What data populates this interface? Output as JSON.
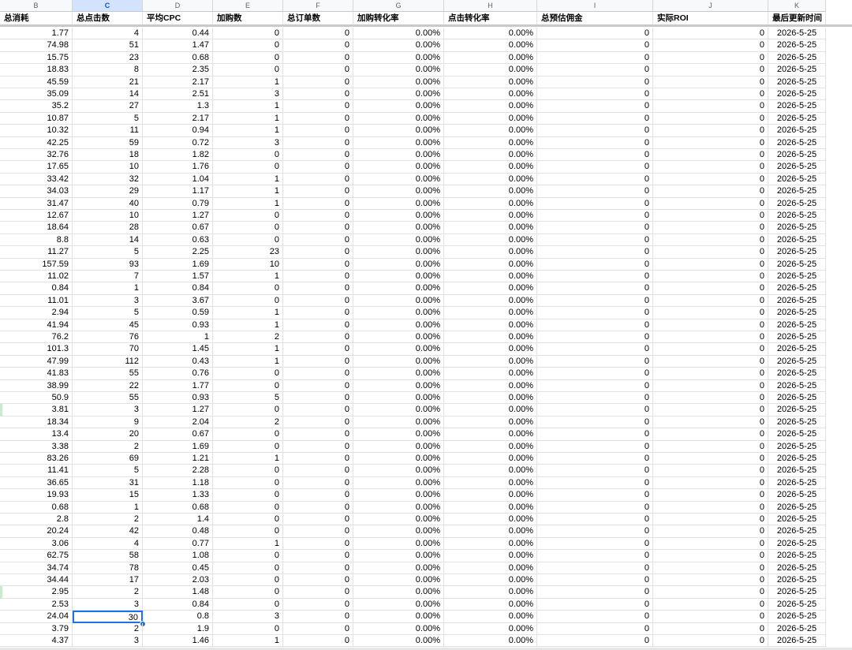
{
  "sheet": {
    "column_letters": [
      "B",
      "C",
      "D",
      "E",
      "F",
      "G",
      "H",
      "I",
      "J",
      "K"
    ],
    "selected_column": "C",
    "headers": [
      "总消耗",
      "总点击数",
      "平均CPC",
      "加购数",
      "总订单数",
      "加购转化率",
      "点击转化率",
      "总预估佣金",
      "实际ROI",
      "最后更新时间"
    ],
    "rows": [
      [
        "1.77",
        "4",
        "0.44",
        "0",
        "0",
        "0.00%",
        "0.00%",
        "0",
        "0",
        "2026-5-25"
      ],
      [
        "74.98",
        "51",
        "1.47",
        "0",
        "0",
        "0.00%",
        "0.00%",
        "0",
        "0",
        "2026-5-25"
      ],
      [
        "15.75",
        "23",
        "0.68",
        "0",
        "0",
        "0.00%",
        "0.00%",
        "0",
        "0",
        "2026-5-25"
      ],
      [
        "18.83",
        "8",
        "2.35",
        "0",
        "0",
        "0.00%",
        "0.00%",
        "0",
        "0",
        "2026-5-25"
      ],
      [
        "45.59",
        "21",
        "2.17",
        "1",
        "0",
        "0.00%",
        "0.00%",
        "0",
        "0",
        "2026-5-25"
      ],
      [
        "35.09",
        "14",
        "2.51",
        "3",
        "0",
        "0.00%",
        "0.00%",
        "0",
        "0",
        "2026-5-25"
      ],
      [
        "35.2",
        "27",
        "1.3",
        "1",
        "0",
        "0.00%",
        "0.00%",
        "0",
        "0",
        "2026-5-25"
      ],
      [
        "10.87",
        "5",
        "2.17",
        "1",
        "0",
        "0.00%",
        "0.00%",
        "0",
        "0",
        "2026-5-25"
      ],
      [
        "10.32",
        "11",
        "0.94",
        "1",
        "0",
        "0.00%",
        "0.00%",
        "0",
        "0",
        "2026-5-25"
      ],
      [
        "42.25",
        "59",
        "0.72",
        "3",
        "0",
        "0.00%",
        "0.00%",
        "0",
        "0",
        "2026-5-25"
      ],
      [
        "32.76",
        "18",
        "1.82",
        "0",
        "0",
        "0.00%",
        "0.00%",
        "0",
        "0",
        "2026-5-25"
      ],
      [
        "17.65",
        "10",
        "1.76",
        "0",
        "0",
        "0.00%",
        "0.00%",
        "0",
        "0",
        "2026-5-25"
      ],
      [
        "33.42",
        "32",
        "1.04",
        "1",
        "0",
        "0.00%",
        "0.00%",
        "0",
        "0",
        "2026-5-25"
      ],
      [
        "34.03",
        "29",
        "1.17",
        "1",
        "0",
        "0.00%",
        "0.00%",
        "0",
        "0",
        "2026-5-25"
      ],
      [
        "31.47",
        "40",
        "0.79",
        "1",
        "0",
        "0.00%",
        "0.00%",
        "0",
        "0",
        "2026-5-25"
      ],
      [
        "12.67",
        "10",
        "1.27",
        "0",
        "0",
        "0.00%",
        "0.00%",
        "0",
        "0",
        "2026-5-25"
      ],
      [
        "18.64",
        "28",
        "0.67",
        "0",
        "0",
        "0.00%",
        "0.00%",
        "0",
        "0",
        "2026-5-25"
      ],
      [
        "8.8",
        "14",
        "0.63",
        "0",
        "0",
        "0.00%",
        "0.00%",
        "0",
        "0",
        "2026-5-25"
      ],
      [
        "11.27",
        "5",
        "2.25",
        "23",
        "0",
        "0.00%",
        "0.00%",
        "0",
        "0",
        "2026-5-25"
      ],
      [
        "157.59",
        "93",
        "1.69",
        "10",
        "0",
        "0.00%",
        "0.00%",
        "0",
        "0",
        "2026-5-25"
      ],
      [
        "11.02",
        "7",
        "1.57",
        "1",
        "0",
        "0.00%",
        "0.00%",
        "0",
        "0",
        "2026-5-25"
      ],
      [
        "0.84",
        "1",
        "0.84",
        "0",
        "0",
        "0.00%",
        "0.00%",
        "0",
        "0",
        "2026-5-25"
      ],
      [
        "11.01",
        "3",
        "3.67",
        "0",
        "0",
        "0.00%",
        "0.00%",
        "0",
        "0",
        "2026-5-25"
      ],
      [
        "2.94",
        "5",
        "0.59",
        "1",
        "0",
        "0.00%",
        "0.00%",
        "0",
        "0",
        "2026-5-25"
      ],
      [
        "41.94",
        "45",
        "0.93",
        "1",
        "0",
        "0.00%",
        "0.00%",
        "0",
        "0",
        "2026-5-25"
      ],
      [
        "76.2",
        "76",
        "1",
        "2",
        "0",
        "0.00%",
        "0.00%",
        "0",
        "0",
        "2026-5-25"
      ],
      [
        "101.3",
        "70",
        "1.45",
        "1",
        "0",
        "0.00%",
        "0.00%",
        "0",
        "0",
        "2026-5-25"
      ],
      [
        "47.99",
        "112",
        "0.43",
        "1",
        "0",
        "0.00%",
        "0.00%",
        "0",
        "0",
        "2026-5-25"
      ],
      [
        "41.83",
        "55",
        "0.76",
        "0",
        "0",
        "0.00%",
        "0.00%",
        "0",
        "0",
        "2026-5-25"
      ],
      [
        "38.99",
        "22",
        "1.77",
        "0",
        "0",
        "0.00%",
        "0.00%",
        "0",
        "0",
        "2026-5-25"
      ],
      [
        "50.9",
        "55",
        "0.93",
        "5",
        "0",
        "0.00%",
        "0.00%",
        "0",
        "0",
        "2026-5-25"
      ],
      [
        "3.81",
        "3",
        "1.27",
        "0",
        "0",
        "0.00%",
        "0.00%",
        "0",
        "0",
        "2026-5-25"
      ],
      [
        "18.34",
        "9",
        "2.04",
        "2",
        "0",
        "0.00%",
        "0.00%",
        "0",
        "0",
        "2026-5-25"
      ],
      [
        "13.4",
        "20",
        "0.67",
        "0",
        "0",
        "0.00%",
        "0.00%",
        "0",
        "0",
        "2026-5-25"
      ],
      [
        "3.38",
        "2",
        "1.69",
        "0",
        "0",
        "0.00%",
        "0.00%",
        "0",
        "0",
        "2026-5-25"
      ],
      [
        "83.26",
        "69",
        "1.21",
        "1",
        "0",
        "0.00%",
        "0.00%",
        "0",
        "0",
        "2026-5-25"
      ],
      [
        "11.41",
        "5",
        "2.28",
        "0",
        "0",
        "0.00%",
        "0.00%",
        "0",
        "0",
        "2026-5-25"
      ],
      [
        "36.65",
        "31",
        "1.18",
        "0",
        "0",
        "0.00%",
        "0.00%",
        "0",
        "0",
        "2026-5-25"
      ],
      [
        "19.93",
        "15",
        "1.33",
        "0",
        "0",
        "0.00%",
        "0.00%",
        "0",
        "0",
        "2026-5-25"
      ],
      [
        "0.68",
        "1",
        "0.68",
        "0",
        "0",
        "0.00%",
        "0.00%",
        "0",
        "0",
        "2026-5-25"
      ],
      [
        "2.8",
        "2",
        "1.4",
        "0",
        "0",
        "0.00%",
        "0.00%",
        "0",
        "0",
        "2026-5-25"
      ],
      [
        "20.24",
        "42",
        "0.48",
        "0",
        "0",
        "0.00%",
        "0.00%",
        "0",
        "0",
        "2026-5-25"
      ],
      [
        "3.06",
        "4",
        "0.77",
        "1",
        "0",
        "0.00%",
        "0.00%",
        "0",
        "0",
        "2026-5-25"
      ],
      [
        "62.75",
        "58",
        "1.08",
        "0",
        "0",
        "0.00%",
        "0.00%",
        "0",
        "0",
        "2026-5-25"
      ],
      [
        "34.74",
        "78",
        "0.45",
        "0",
        "0",
        "0.00%",
        "0.00%",
        "0",
        "0",
        "2026-5-25"
      ],
      [
        "34.44",
        "17",
        "2.03",
        "0",
        "0",
        "0.00%",
        "0.00%",
        "0",
        "0",
        "2026-5-25"
      ],
      [
        "2.95",
        "2",
        "1.48",
        "0",
        "0",
        "0.00%",
        "0.00%",
        "0",
        "0",
        "2026-5-25"
      ],
      [
        "2.53",
        "3",
        "0.84",
        "0",
        "0",
        "0.00%",
        "0.00%",
        "0",
        "0",
        "2026-5-25"
      ],
      [
        "24.04",
        "30",
        "0.8",
        "3",
        "0",
        "0.00%",
        "0.00%",
        "0",
        "0",
        "2026-5-25"
      ],
      [
        "3.79",
        "2",
        "1.9",
        "0",
        "0",
        "0.00%",
        "0.00%",
        "0",
        "0",
        "2026-5-25"
      ],
      [
        "4.37",
        "3",
        "1.46",
        "1",
        "0",
        "0.00%",
        "0.00%",
        "0",
        "0",
        "2026-5-25"
      ]
    ],
    "active_cell": {
      "row": 48,
      "col": 1
    },
    "highlighted_rows": [
      31,
      46
    ],
    "colors": {
      "selection": "#1a73e8",
      "selected_header_bg": "#d3e3fd",
      "row_marker": "#cde9d3"
    }
  }
}
